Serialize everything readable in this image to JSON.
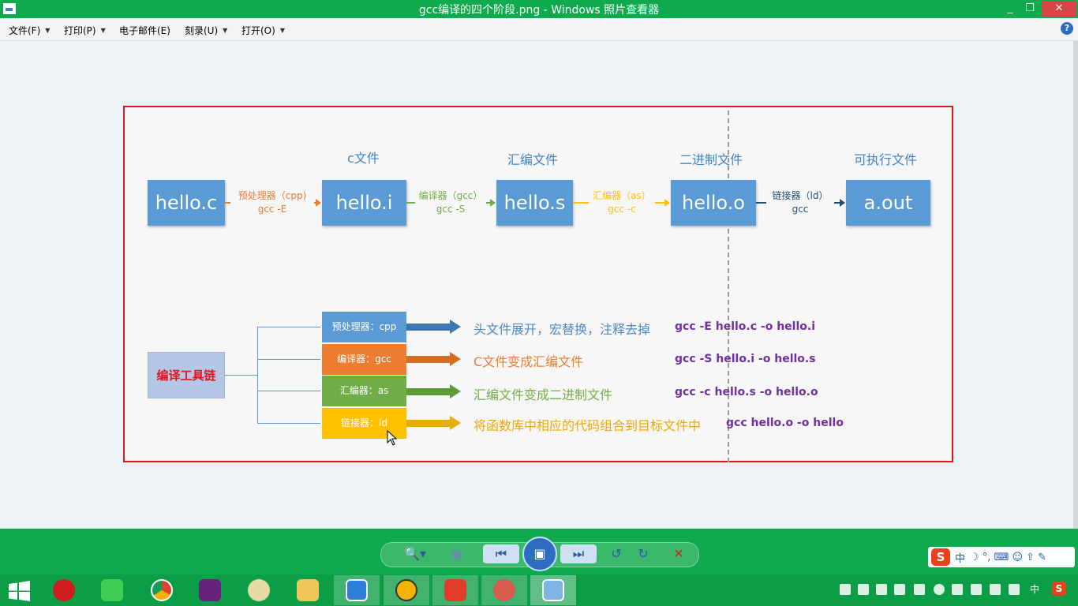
{
  "window": {
    "title": "gcc编译的四个阶段.png - Windows 照片查看器",
    "minimize": "_",
    "restore": "❐",
    "close": "✕"
  },
  "menu": {
    "file": "文件(F)",
    "print": "打印(P)",
    "email": "电子邮件(E)",
    "burn": "刻录(U)",
    "open": "打开(O)",
    "help": "?"
  },
  "diagram": {
    "stage_labels": {
      "c": "c文件",
      "asm": "汇编文件",
      "bin": "二进制文件",
      "exe": "可执行文件"
    },
    "files": [
      "hello.c",
      "hello.i",
      "hello.s",
      "hello.o",
      "a.out"
    ],
    "tools": [
      {
        "name": "预处理器（cpp)",
        "cmd": "gcc -E",
        "color": "#ed7d31"
      },
      {
        "name": "编译器（gcc）",
        "cmd": "gcc -S",
        "color": "#70ad47"
      },
      {
        "name": "汇编器（as）",
        "cmd": "gcc -c",
        "color": "#ffc000"
      },
      {
        "name": "链接器（ld）",
        "cmd": "gcc",
        "color": "#1f4e79"
      }
    ],
    "toolchain_label": "编译工具链",
    "chain": [
      {
        "label": "预处理器：cpp",
        "desc": "头文件展开，宏替换，注释去掉",
        "cmd": "gcc -E hello.c -o hello.i",
        "color": "#4f87c2",
        "desc_color": "#4f87c2"
      },
      {
        "label": "编译器：gcc",
        "desc": "C文件变成汇编文件",
        "cmd": "gcc -S hello.i -o hello.s",
        "color": "#ed7d31",
        "desc_color": "#ed7d31"
      },
      {
        "label": "汇编器：as",
        "desc": "汇编文件变成二进制文件",
        "cmd": "gcc -c hello.s -o hello.o",
        "color": "#70ad47",
        "desc_color": "#70ad47"
      },
      {
        "label": "链接器：ld",
        "desc": "将函数库中相应的代码组合到目标文件中",
        "cmd": "gcc hello.o -o hello",
        "color": "#ffc000",
        "desc_color": "#f0a800"
      }
    ]
  },
  "controls": {
    "zoom": "🔍▾",
    "fit": "▣",
    "prev": "⏮",
    "slideshow": "▣",
    "next": "⏭",
    "rotate_left": "↺",
    "rotate_right": "↻",
    "delete": "✕"
  },
  "ime": {
    "logo": "S",
    "mode": "中",
    "extras": "☽ °, ⌨ ☺ ⇧ ✎"
  },
  "taskbar": {
    "tray_lang": "中",
    "tray_ime": "S"
  }
}
